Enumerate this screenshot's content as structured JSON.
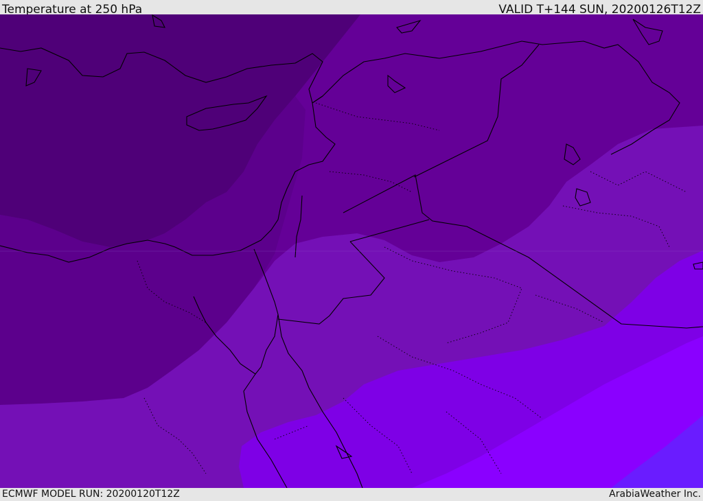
{
  "header": {
    "title": "Temperature at 250 hPa",
    "valid_time": "VALID T+144 SUN, 20200126T12Z"
  },
  "footer": {
    "model_run": "ECMWF MODEL RUN: 20200120T12Z",
    "credit": "ArabiaWeather Inc."
  },
  "palette": {
    "band_darkest": "#4f0078",
    "band_dark": "#640097",
    "band_mid": "#7410b6",
    "band_bright": "#7e00e6",
    "band_brighter": "#8a00ff",
    "band_blue": "#6a1cff",
    "coastline": "#000000",
    "bar_background": "#e6e6e6"
  }
}
